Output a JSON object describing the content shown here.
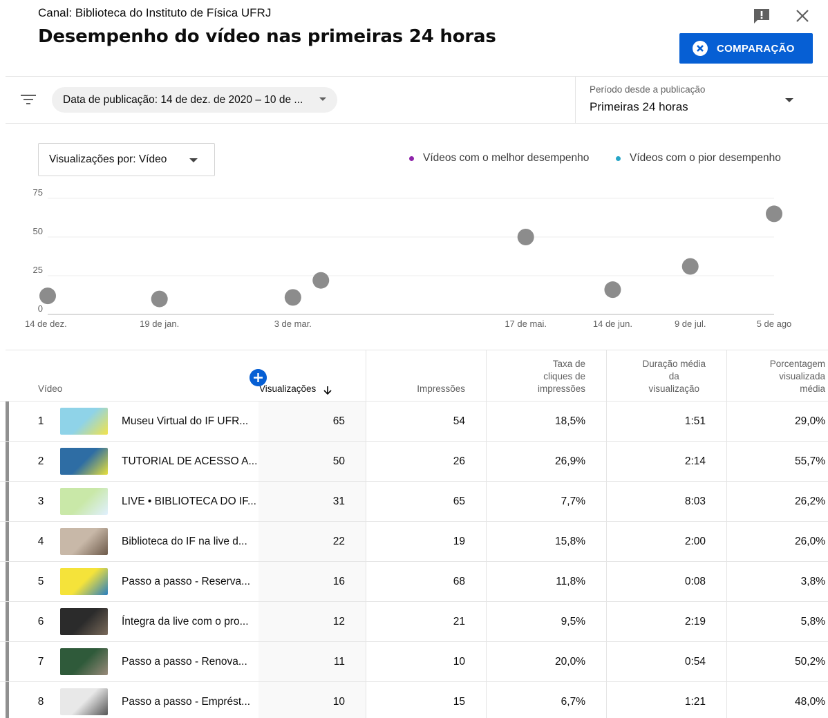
{
  "header": {
    "channel": "Canal: Biblioteca do Instituto de Física UFRJ",
    "title": "Desempenho do vídeo nas primeiras 24 horas",
    "compare_label": "COMPARAÇÃO",
    "icons": [
      "feedback-icon",
      "close-icon",
      "close-circle-icon"
    ]
  },
  "filters": {
    "chip_label": "Data de publicação: 14 de dez. de 2020 – 10 de ...",
    "period_label": "Período desde a publicação",
    "period_value": "Primeiras 24 horas",
    "icons": [
      "filter-icon",
      "chevron-down-icon"
    ]
  },
  "chart_controls": {
    "views_by": "Visualizações por: Vídeo",
    "legend": [
      {
        "label": "Vídeos com o melhor desempenho",
        "color": "#8e24aa"
      },
      {
        "label": "Vídeos com o pior desempenho",
        "color": "#26a5c7"
      }
    ]
  },
  "chart_data": {
    "type": "scatter",
    "x_ticks": [
      "14 de dez.",
      "19 de jan.",
      "3 de mar.",
      "17 de mai.",
      "14 de jun.",
      "9 de jul.",
      "5 de ago"
    ],
    "y_ticks": [
      "0",
      "25",
      "50",
      "75"
    ],
    "ylim": [
      0,
      75
    ],
    "grid": true,
    "point_color": "#8c8c8c",
    "points": [
      {
        "x": "2020-12-14",
        "y": 12
      },
      {
        "x": "2021-01-19",
        "y": 10
      },
      {
        "x": "2021-03-03",
        "y": 11
      },
      {
        "x": "2021-03-12",
        "y": 22
      },
      {
        "x": "2021-05-17",
        "y": 50
      },
      {
        "x": "2021-06-14",
        "y": 16
      },
      {
        "x": "2021-07-09",
        "y": 31
      },
      {
        "x": "2021-08-05",
        "y": 65
      }
    ]
  },
  "table": {
    "columns": {
      "video": "Vídeo",
      "views": "Visualizações",
      "impressions": "Impressões",
      "ctr": [
        "Taxa de",
        "cliques de",
        "impressões"
      ],
      "avg_duration": [
        "Duração média",
        "da",
        "visualização"
      ],
      "avg_pct": [
        "Porcentagem",
        "visualizada",
        "média"
      ]
    },
    "icons": [
      "add-icon",
      "arrow-down-icon"
    ],
    "rows": [
      {
        "rank": "1",
        "title": "Museu Virtual do IF UFR...",
        "views": "65",
        "impressions": "54",
        "ctr": "18,5%",
        "duration": "1:51",
        "pct": "29,0%",
        "thumb": [
          "#8fd3e8",
          "#f2e34a"
        ]
      },
      {
        "rank": "2",
        "title": "TUTORIAL DE ACESSO A...",
        "views": "50",
        "impressions": "26",
        "ctr": "26,9%",
        "duration": "2:14",
        "pct": "55,7%",
        "thumb": [
          "#2e6da4",
          "#e8e03a"
        ]
      },
      {
        "rank": "3",
        "title": "LIVE • BIBLIOTECA DO IF...",
        "views": "31",
        "impressions": "65",
        "ctr": "7,7%",
        "duration": "8:03",
        "pct": "26,2%",
        "thumb": [
          "#c9e8a8",
          "#e0f0ff"
        ]
      },
      {
        "rank": "4",
        "title": "Biblioteca do IF na live d...",
        "views": "22",
        "impressions": "19",
        "ctr": "15,8%",
        "duration": "2:00",
        "pct": "26,0%",
        "thumb": [
          "#c8b8a8",
          "#6d5a4a"
        ]
      },
      {
        "rank": "5",
        "title": "Passo a passo - Reserva...",
        "views": "16",
        "impressions": "68",
        "ctr": "11,8%",
        "duration": "0:08",
        "pct": "3,8%",
        "thumb": [
          "#f5e33a",
          "#2a7fbf"
        ]
      },
      {
        "rank": "6",
        "title": "Íntegra da live com o pro...",
        "views": "12",
        "impressions": "21",
        "ctr": "9,5%",
        "duration": "2:19",
        "pct": "5,8%",
        "thumb": [
          "#2b2b2b",
          "#7a6a5a"
        ]
      },
      {
        "rank": "7",
        "title": "Passo a passo - Renova...",
        "views": "11",
        "impressions": "10",
        "ctr": "20,0%",
        "duration": "0:54",
        "pct": "50,2%",
        "thumb": [
          "#2f5a3a",
          "#9a8a7a"
        ]
      },
      {
        "rank": "8",
        "title": "Passo a passo - Emprést...",
        "views": "10",
        "impressions": "15",
        "ctr": "6,7%",
        "duration": "1:21",
        "pct": "48,0%",
        "thumb": [
          "#e8e8e8",
          "#555555"
        ]
      }
    ]
  }
}
